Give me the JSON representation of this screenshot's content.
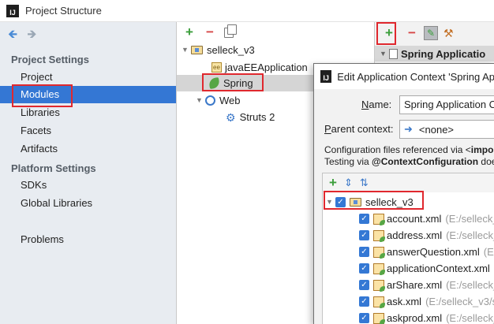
{
  "window": {
    "title": "Project Structure",
    "logo": "IJ"
  },
  "sidebar": {
    "sections": [
      {
        "title": "Project Settings",
        "items": [
          "Project",
          "Modules",
          "Libraries",
          "Facets",
          "Artifacts"
        ]
      },
      {
        "title": "Platform Settings",
        "items": [
          "SDKs",
          "Global Libraries"
        ]
      }
    ],
    "extra_items": [
      "Problems"
    ],
    "selected": "Modules"
  },
  "module_tree": {
    "root": "selleck_v3",
    "children": [
      {
        "label": "javaEEApplication",
        "icon": "javaee-icon"
      },
      {
        "label": "Spring",
        "icon": "spring-leaf-icon",
        "selected": true
      },
      {
        "label": "Web",
        "icon": "web-icon"
      }
    ],
    "web_children": [
      {
        "label": "Struts 2",
        "icon": "gear-icon"
      }
    ]
  },
  "right_panel": {
    "first_row": "Spring Applicatio"
  },
  "dialog": {
    "title": "Edit Application Context 'Spring Ap",
    "name_label_u": "N",
    "name_label_rest": "ame:",
    "name_value": "Spring Application C",
    "parent_label_u": "P",
    "parent_label_rest": "arent context:",
    "parent_value": "<none>",
    "info_line1_a": "Configuration files referenced via <",
    "info_line1_b": "impor",
    "info_line2_a": "Testing via ",
    "info_line2_b": "@ContextConfiguration",
    "info_line2_c": " does",
    "module_root": "selleck_v3",
    "files": [
      {
        "name": "account.xml",
        "path": "(E:/selleck_"
      },
      {
        "name": "address.xml",
        "path": "(E:/selleck_"
      },
      {
        "name": "answerQuestion.xml",
        "path": "(E:/"
      },
      {
        "name": "applicationContext.xml",
        "path": ""
      },
      {
        "name": "arShare.xml",
        "path": "(E:/selleck_"
      },
      {
        "name": "ask.xml",
        "path": "(E:/selleck_v3/s"
      },
      {
        "name": "askprod.xml",
        "path": "(E:/selleck_"
      }
    ]
  },
  "colors": {
    "selection": "#3477d4",
    "highlight_box": "#e0282e",
    "add": "#3b9e3b",
    "remove": "#d64545"
  }
}
